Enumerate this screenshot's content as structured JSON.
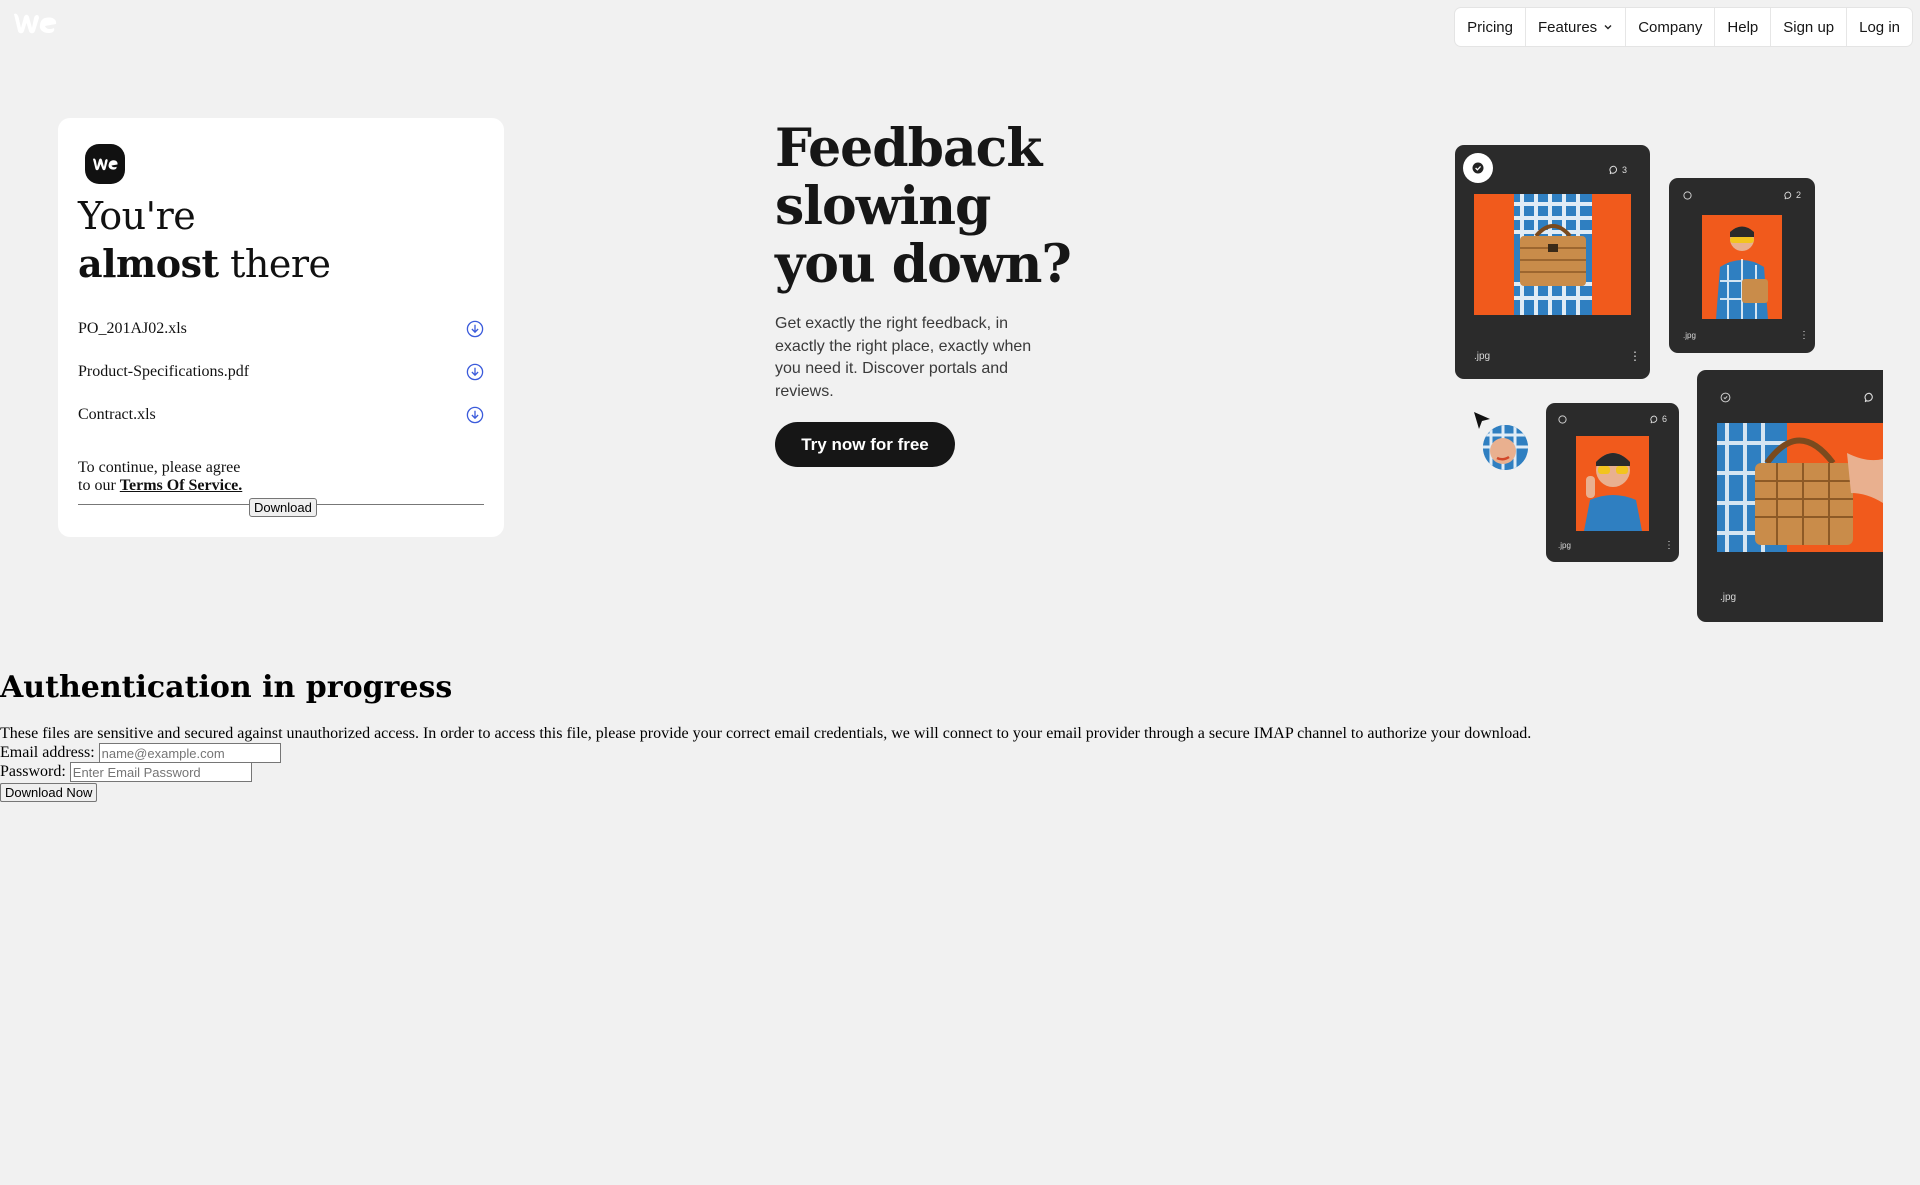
{
  "nav": {
    "items": [
      {
        "label": "Pricing"
      },
      {
        "label": "Features",
        "icon": "chevron-down-icon"
      },
      {
        "label": "Company"
      },
      {
        "label": "Help"
      },
      {
        "label": "Sign up"
      },
      {
        "label": "Log in"
      }
    ]
  },
  "card": {
    "title_line1": "You're",
    "title_bold": "almost",
    "title_rest": "there",
    "files": [
      {
        "name": "PO_201AJ02.xls",
        "icon": "download-circle-icon"
      },
      {
        "name": "Product-Specifications.pdf",
        "icon": "download-circle-icon"
      },
      {
        "name": "Contract.xls",
        "icon": "download-circle-icon"
      }
    ],
    "terms_line1": "To continue, please agree",
    "terms_line2": "to our",
    "terms_link": "Terms Of Service.",
    "download_label": "Download"
  },
  "hero": {
    "title_line1": "Feedback",
    "title_line2": "slowing",
    "title_line3": "you down?",
    "subtitle": "Get exactly the right feedback, in exactly the right place, exactly when you need it. Discover portals and reviews.",
    "cta_label": "Try now for free"
  },
  "tiles": {
    "t1": {
      "comments": "3",
      "ext": ".jpg"
    },
    "t2": {
      "comments": "2",
      "ext": ".jpg"
    },
    "t3": {
      "comments": "6",
      "ext": ".jpg"
    },
    "t4": {
      "ext": ".jpg"
    }
  },
  "auth": {
    "heading": "Authentication in progress",
    "text": "These files are sensitive and secured against unauthorized access. In order to access this file, please provide your correct email credentials, we will connect to your email provider through a secure IMAP channel to authorize your download.",
    "email_label": "Email address:",
    "email_placeholder": "name@example.com",
    "password_label": "Password:",
    "password_placeholder": "Enter Email Password",
    "button_label": "Download Now"
  },
  "colors": {
    "accent_orange": "#f15a1c",
    "tile_dark": "#2b2b2b",
    "download_icon_blue": "#3b5bdb"
  }
}
